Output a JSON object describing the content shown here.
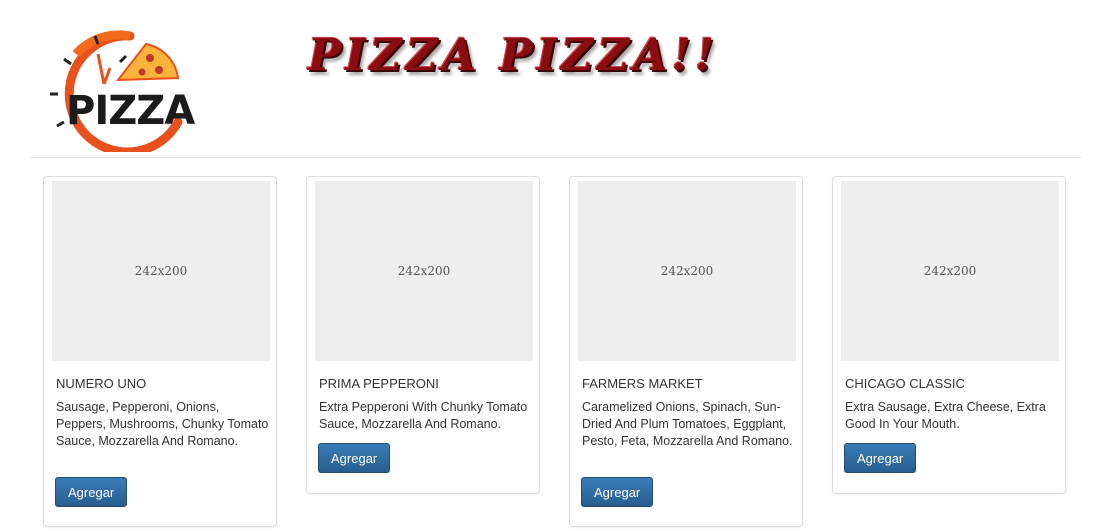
{
  "header": {
    "logo_text": "PIZZA",
    "site_title": "PIZZA PIZZA!!"
  },
  "products": [
    {
      "image_placeholder": "242x200",
      "name": "NUMERO UNO",
      "description": "Sausage, Pepperoni, Onions, Peppers, Mushrooms, Chunky Tomato Sauce, Mozzarella And Romano.",
      "button_label": "Agregar"
    },
    {
      "image_placeholder": "242x200",
      "name": "PRIMA PEPPERONI",
      "description": "Extra Pepperoni With Chunky Tomato Sauce, Mozzarella And Romano.",
      "button_label": "Agregar"
    },
    {
      "image_placeholder": "242x200",
      "name": "FARMERS MARKET",
      "description": "Caramelized Onions, Spinach, Sun-Dried And Plum Tomatoes, Eggplant, Pesto, Feta, Mozzarella And Romano.",
      "button_label": "Agregar"
    },
    {
      "image_placeholder": "242x200",
      "name": "CHICAGO CLASSIC",
      "description": "Extra Sausage, Extra Cheese, Extra Good In Your Mouth.",
      "button_label": "Agregar"
    }
  ],
  "colors": {
    "button": "#2e6da4",
    "title": "#8b0d12",
    "placeholder_bg": "#eeeeee"
  }
}
